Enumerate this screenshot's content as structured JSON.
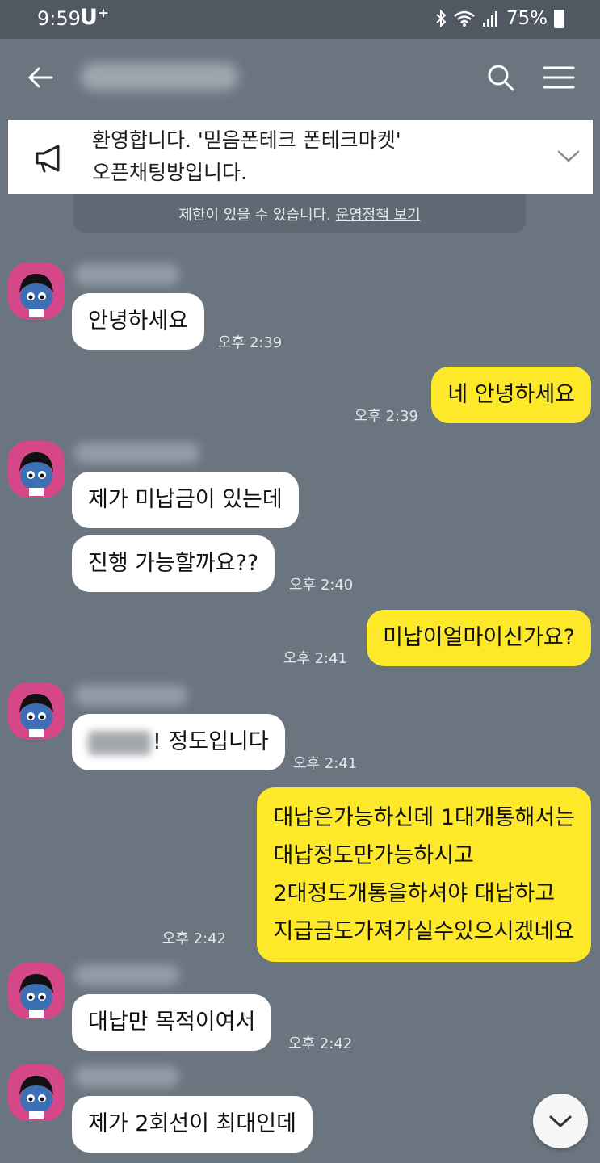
{
  "status_bar": {
    "time": "9:59",
    "carrier": "U⁺",
    "battery": "75%"
  },
  "header": {
    "back_icon": "back-arrow-icon",
    "search_icon": "search-icon",
    "menu_icon": "hamburger-menu-icon"
  },
  "announcement": {
    "line1": "환영합니다. '믿음폰테크 폰테크마켓'",
    "line2": "오픈채팅방입니다."
  },
  "notice": {
    "text": "제한이 있을 수 있습니다.",
    "link": "운영정책 보기"
  },
  "messages": [
    {
      "text": "안녕하세요",
      "time": "오후 2:39"
    },
    {
      "text": "네 안녕하세요",
      "time": "오후 2:39"
    },
    {
      "text": "제가 미납금이 있는데"
    },
    {
      "text": "진행 가능할까요??",
      "time": "오후 2:40"
    },
    {
      "text": "미납이얼마이신가요?",
      "time": "오후 2:41"
    },
    {
      "text": "! 정도입니다",
      "time": "오후 2:41"
    },
    {
      "lines": [
        "대납은가능하신데 1대개통해서는",
        "대납정도만가능하시고",
        "2대정도개통을하셔야 대납하고",
        "지급금도가져가실수있으시겠네요"
      ],
      "time": "오후 2:42"
    },
    {
      "text": "대납만 목적이여서",
      "time": "오후 2:42"
    },
    {
      "text": "제가 2회선이 최대인데"
    }
  ],
  "colors": {
    "background": "#6b7580",
    "my_bubble": "#fde829",
    "other_bubble": "#ffffff",
    "avatar": "#d6478a"
  }
}
